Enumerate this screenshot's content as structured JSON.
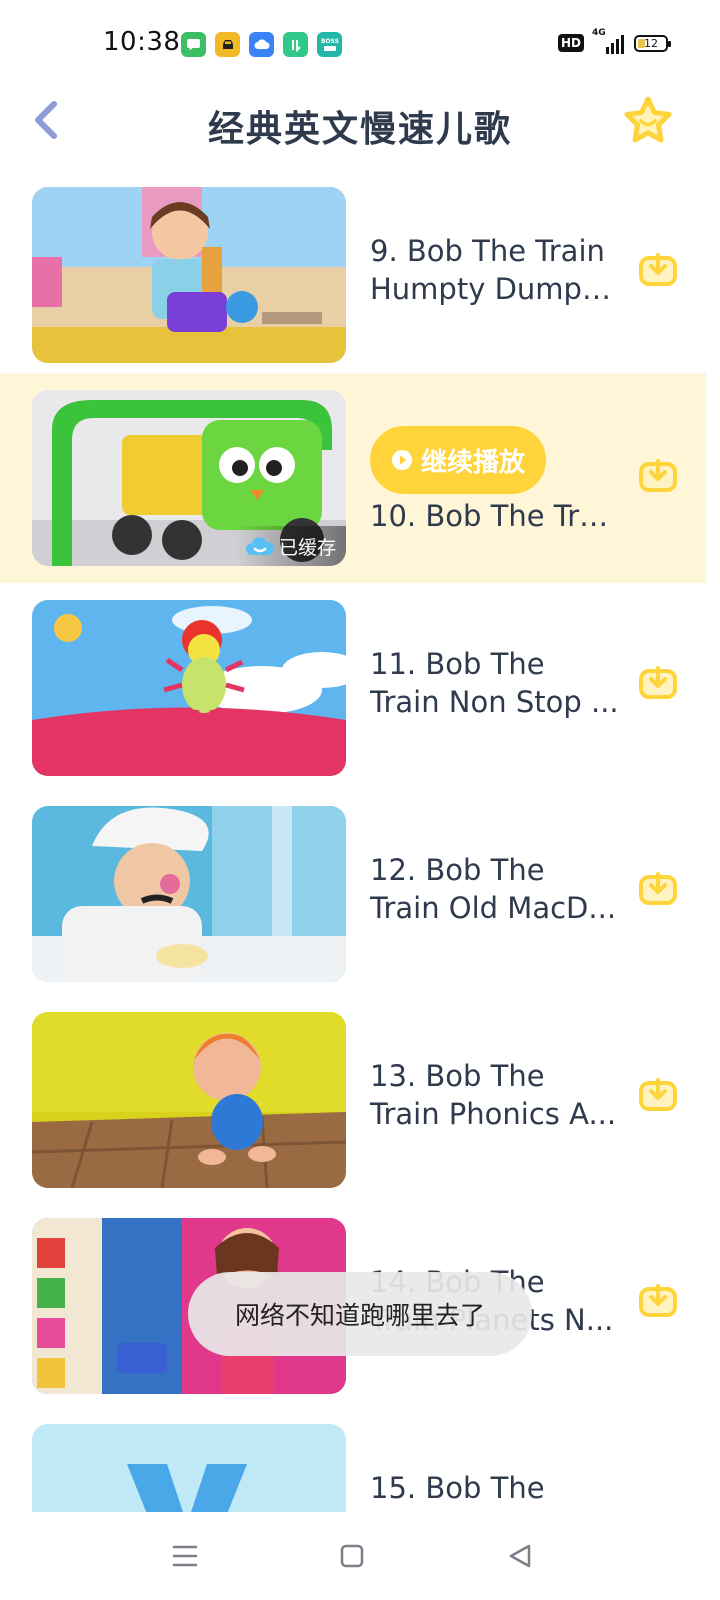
{
  "status_bar": {
    "time": "10:38",
    "hd_label": "HD",
    "network_label": "4G",
    "battery_level": "12",
    "notification_icons": [
      "messages-icon",
      "car-app-icon",
      "cloud-app-icon",
      "finance-app-icon",
      "boss-recruit-icon"
    ],
    "notification_colors": [
      "#3bbf62",
      "#f2b927",
      "#3b82f6",
      "#2fc98a",
      "#22b8a9"
    ]
  },
  "header": {
    "title": "经典英文慢速儿歌",
    "back_icon": "chevron-left-icon",
    "favorite_icon": "star-icon"
  },
  "items": [
    {
      "line1": "9. Bob The Train",
      "line2": "Humpty Dumpt...",
      "state": "normal"
    },
    {
      "line1": "",
      "line2": "10. Bob The Tra...",
      "state": "playing",
      "continue_label": "继续播放",
      "cached_label": "已缓存"
    },
    {
      "line1": "11. Bob The",
      "line2": "Train Non Stop ...",
      "state": "normal"
    },
    {
      "line1": "12. Bob The",
      "line2": "Train Old MacD...",
      "state": "normal"
    },
    {
      "line1": "13. Bob The",
      "line2": "Train Phonics A...",
      "state": "normal"
    },
    {
      "line1": "14. Bob The",
      "line2": "Train Planets N...",
      "state": "normal"
    },
    {
      "line1": "15. Bob The",
      "line2": "",
      "state": "normal"
    }
  ],
  "toast": {
    "message": "网络不知道跑哪里去了"
  },
  "nav": {
    "menu_icon": "menu-icon",
    "home_icon": "home-square-icon",
    "back_icon": "back-triangle-icon"
  },
  "colors": {
    "accent": "#ffd43b",
    "active_row": "#fff6d8",
    "title_text": "#2f3a4d",
    "back_arrow": "#8f9bd6"
  }
}
